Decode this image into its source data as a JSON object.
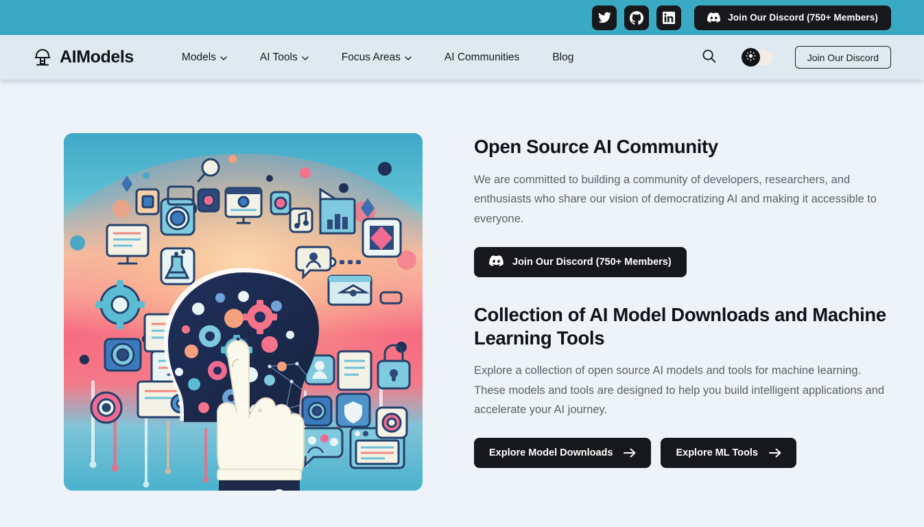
{
  "topbar": {
    "background": "#3aa9c4",
    "socials": [
      {
        "name": "twitter",
        "label": "Twitter"
      },
      {
        "name": "github",
        "label": "GitHub"
      },
      {
        "name": "linkedin",
        "label": "LinkedIn"
      }
    ],
    "discord_button": {
      "label": "Join Our Discord (750+ Members)",
      "icon": "discord-icon",
      "background": "#17181b"
    }
  },
  "nav": {
    "background": "#dfeaf0",
    "brand": {
      "name": "AIModels",
      "icon": "robot-logo-icon"
    },
    "links": [
      {
        "label": "Models",
        "has_dropdown": true
      },
      {
        "label": "AI Tools",
        "has_dropdown": true
      },
      {
        "label": "Focus Areas",
        "has_dropdown": true
      },
      {
        "label": "AI Communities",
        "has_dropdown": false
      },
      {
        "label": "Blog",
        "has_dropdown": false
      }
    ],
    "search": {
      "icon": "search-icon"
    },
    "theme_toggle": {
      "state": "light",
      "icon": "sun-icon"
    },
    "cta": {
      "label": "Join Our Discord"
    }
  },
  "hero": {
    "image": {
      "alt": "AI illustration: human head silhouette filled with colorful gears surrounded by technology icons, with a pointing hand",
      "icon": "ai-brain-illustration"
    },
    "sections": [
      {
        "title": "Open Source AI Community",
        "body": "We are committed to building a community of developers, researchers, and enthusiasts who share our vision of democratizing AI and making it accessible to everyone.",
        "buttons": [
          {
            "label": "Join Our Discord (750+ Members)",
            "icon": "discord-icon"
          }
        ]
      },
      {
        "title": "Collection of AI Model Downloads and Machine Learning Tools",
        "body": "Explore a collection of open source AI models and tools for machine learning. These models and tools are designed to help you build intelligent applications and accelerate your AI journey.",
        "buttons": [
          {
            "label": "Explore Model Downloads",
            "icon": "arrow-right-icon"
          },
          {
            "label": "Explore ML Tools",
            "icon": "arrow-right-icon"
          }
        ]
      }
    ]
  },
  "colors": {
    "page_background": "#eef3fa",
    "topbar": "#3aa9c4",
    "navbar": "#dfeaf0",
    "dark_button": "#17181b",
    "body_text": "#59616b",
    "heading_text": "#0f1317"
  }
}
